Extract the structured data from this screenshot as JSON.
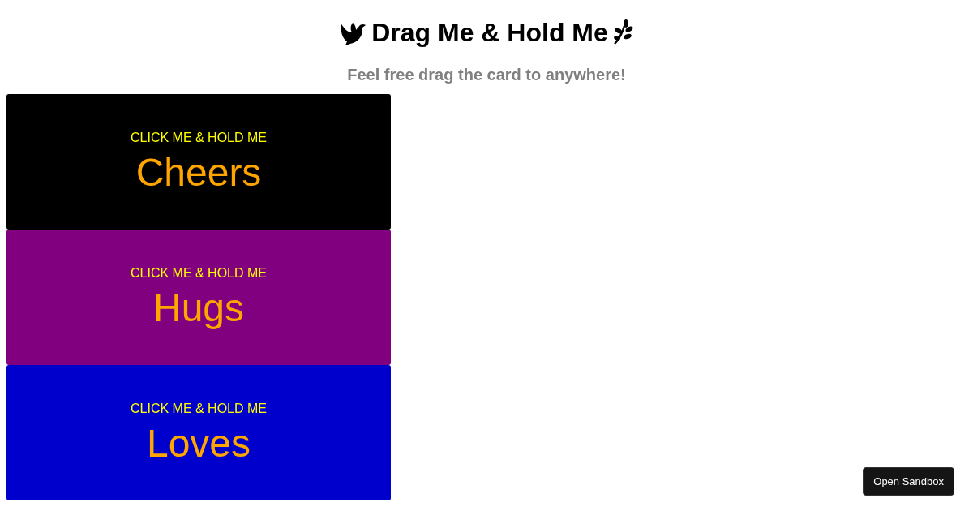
{
  "header": {
    "title": "Drag Me & Hold Me",
    "subtitle": "Feel free drag the card to anywhere!"
  },
  "cards": [
    {
      "prompt": "CLICK ME & HOLD ME",
      "word": "Cheers",
      "color": "#000000"
    },
    {
      "prompt": "CLICK ME & HOLD ME",
      "word": "Hugs",
      "color": "#800080"
    },
    {
      "prompt": "CLICK ME & HOLD ME",
      "word": "Loves",
      "color": "#0000cd"
    }
  ],
  "sandbox_button": {
    "label": "Open Sandbox"
  }
}
